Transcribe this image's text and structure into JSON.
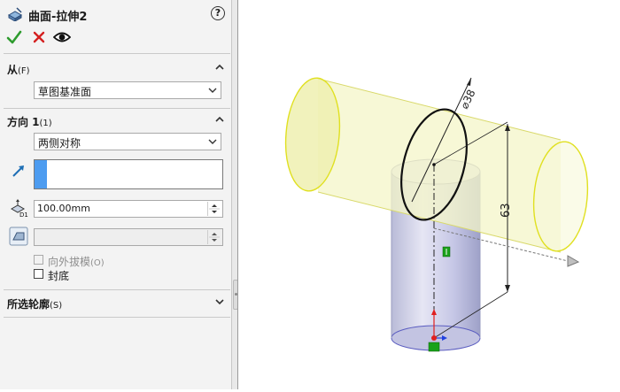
{
  "feature": {
    "title": "曲面-拉伸2",
    "icon": "surface-extrude-icon"
  },
  "actions": {
    "ok_icon": "check-icon",
    "cancel_icon": "close-icon",
    "preview_icon": "eye-icon"
  },
  "from_section": {
    "title": "从",
    "shortcut": "(F)",
    "value": "草图基准面"
  },
  "direction_section": {
    "title": "方向 1",
    "shortcut": "(1)",
    "end_condition": "两侧对称",
    "depth": "100.00mm",
    "draft_outward_label": "向外拔模",
    "draft_outward_shortcut": "(O)",
    "cap_end_label": "封底"
  },
  "contours_section": {
    "title": "所选轮廓",
    "shortcut": "(S)"
  },
  "model": {
    "diameter_label": "⌀38",
    "height_label": "63"
  },
  "colors": {
    "panel_bg": "#f3f3f3",
    "ok_green": "#2e9b2e",
    "cancel_red": "#d42020",
    "selection_blue": "#4d9cf0",
    "horizontal_tube": "#f4f6c8",
    "vertical_cylinder": "#cfd0ea"
  }
}
